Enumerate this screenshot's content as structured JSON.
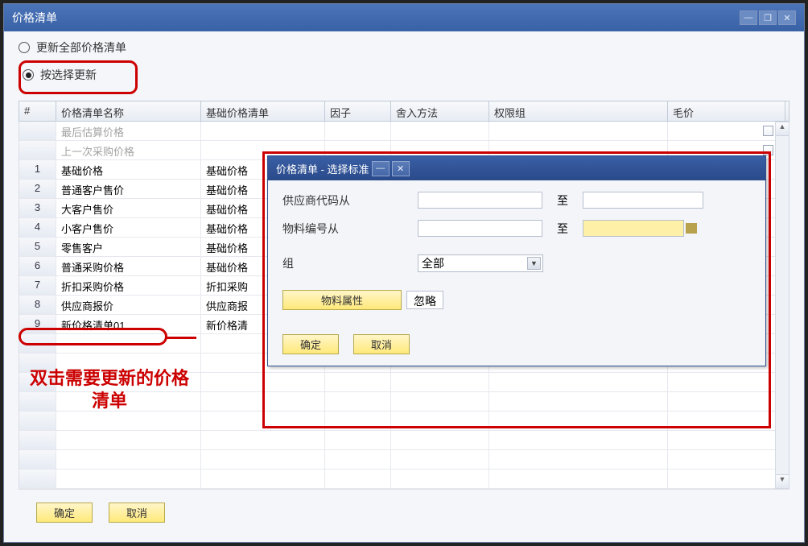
{
  "main": {
    "title": "价格清单",
    "radios": {
      "update_all": "更新全部价格清单",
      "update_selected": "按选择更新"
    },
    "columns": {
      "num": "#",
      "name": "价格清单名称",
      "base": "基础价格清单",
      "factor": "因子",
      "round": "舍入方法",
      "perm": "权限组",
      "mao": "毛价"
    },
    "rows": [
      {
        "num": "",
        "name": "最后估算价格",
        "base": "",
        "grey": true
      },
      {
        "num": "",
        "name": "上一次采购价格",
        "base": "",
        "grey": true
      },
      {
        "num": "1",
        "name": "基础价格",
        "base": "基础价格"
      },
      {
        "num": "2",
        "name": "普通客户售价",
        "base": "基础价格"
      },
      {
        "num": "3",
        "name": "大客户售价",
        "base": "基础价格"
      },
      {
        "num": "4",
        "name": "小客户售价",
        "base": "基础价格"
      },
      {
        "num": "5",
        "name": "零售客户",
        "base": "基础价格"
      },
      {
        "num": "6",
        "name": "普通采购价格",
        "base": "基础价格"
      },
      {
        "num": "7",
        "name": "折扣采购价格",
        "base": "折扣采购"
      },
      {
        "num": "8",
        "name": "供应商报价",
        "base": "供应商报"
      },
      {
        "num": "9",
        "name": "新价格清单01",
        "base": "新价格清"
      }
    ],
    "buttons": {
      "ok": "确定",
      "cancel": "取消"
    },
    "annot": "双击需要更新的价格清单"
  },
  "dialog": {
    "title": "价格清单 - 选择标准",
    "supplier_from": "供应商代码从",
    "material_from": "物料编号从",
    "to": "至",
    "group": "组",
    "group_value": "全部",
    "attr_btn": "物料属性",
    "attr_value": "忽略",
    "ok": "确定",
    "cancel": "取消"
  }
}
